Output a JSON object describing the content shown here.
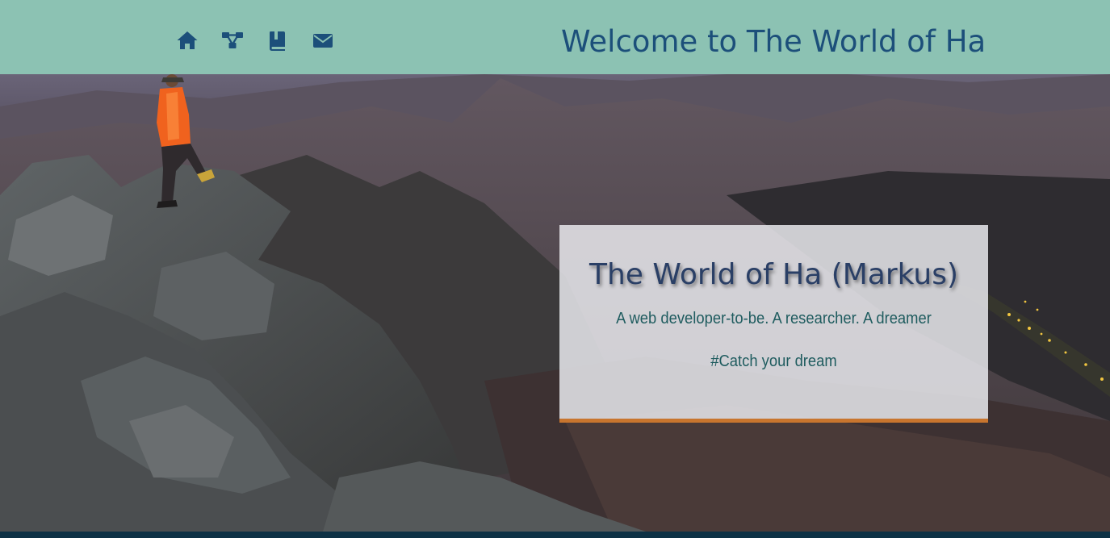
{
  "header": {
    "title": "Welcome to The World of Ha",
    "background_color": "#8cc2b3",
    "title_color": "#1c4f7a",
    "nav": [
      {
        "icon": "home-icon",
        "color": "#1c4f7a"
      },
      {
        "icon": "network-icon",
        "color": "#1c4f7a"
      },
      {
        "icon": "book-icon",
        "color": "#1c4f7a"
      },
      {
        "icon": "envelope-icon",
        "color": "#1c4f7a"
      }
    ]
  },
  "hero": {
    "image": "hiker-on-mountain-ridge",
    "card": {
      "heading": "The World of Ha (Markus)",
      "tagline": "A web developer-to-be. A researcher. A dreamer",
      "motto": "#Catch your dream",
      "accent_color": "#c8752e"
    }
  },
  "footer": {
    "color": "#0d3145"
  }
}
